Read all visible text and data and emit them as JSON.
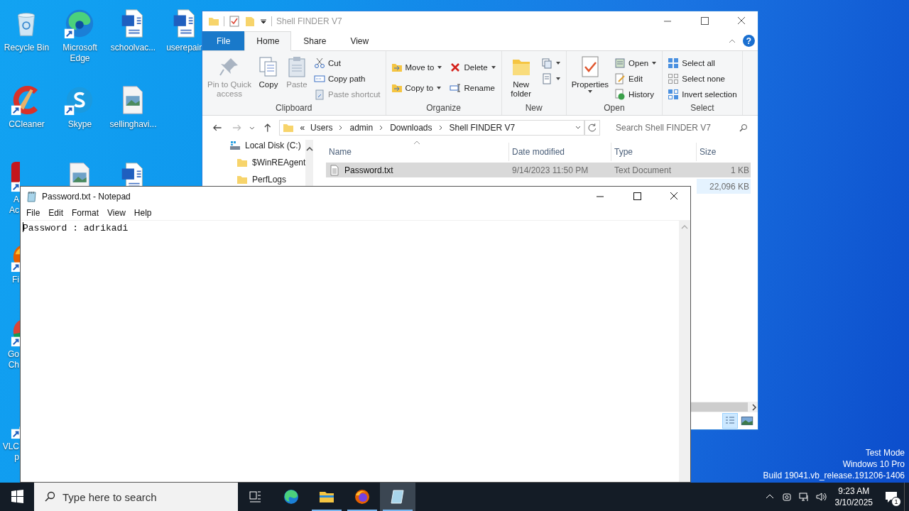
{
  "desktop_icons": [
    {
      "kind": "recycle",
      "label": "Recycle Bin"
    },
    {
      "kind": "edge",
      "label": "Microsoft Edge",
      "shortcut": true
    },
    {
      "kind": "word",
      "label": "schoolvac..."
    },
    {
      "kind": "word",
      "label": "userepair."
    },
    {
      "kind": "ccleaner",
      "label": "CCleaner",
      "shortcut": true
    },
    {
      "kind": "skype",
      "label": "Skype",
      "shortcut": true
    },
    {
      "kind": "image",
      "label": "sellinghavi..."
    },
    {
      "kind": "acrobat",
      "label": "A Ac",
      "shortcut": true
    },
    {
      "kind": "image"
    },
    {
      "kind": "word"
    },
    {
      "kind": "firefox",
      "label": "Fi",
      "shortcut": true
    },
    {
      "kind": "chrome",
      "label": "Go Ch",
      "shortcut": true
    },
    {
      "kind": "vlc",
      "label": "VLC p",
      "shortcut": true
    }
  ],
  "explorer": {
    "title": "Shell FINDER V7",
    "help": "?",
    "tabs": [
      {
        "label": "File",
        "kind": "file",
        "selected": false
      },
      {
        "label": "Home",
        "kind": "tab",
        "selected": true
      },
      {
        "label": "Share",
        "kind": "tab",
        "selected": false
      },
      {
        "label": "View",
        "kind": "tab",
        "selected": false
      }
    ],
    "ribbon": [
      {
        "label": "Clipboard",
        "items": [
          {
            "kind": "large",
            "label": "Pin to Quick access",
            "disabled": true
          },
          {
            "kind": "large",
            "label": "Copy",
            "disabled": false
          },
          {
            "kind": "large",
            "label": "Paste",
            "disabled": true
          },
          {
            "kind": "small",
            "label": "Cut",
            "disabled": false
          },
          {
            "kind": "small",
            "label": "Copy path",
            "disabled": false
          },
          {
            "kind": "small",
            "label": "Paste shortcut",
            "disabled": true
          }
        ]
      },
      {
        "label": "Organize",
        "items": [
          {
            "kind": "small",
            "label": "Move to",
            "dropdown": true
          },
          {
            "kind": "small",
            "label": "Copy to",
            "dropdown": true
          },
          {
            "kind": "small",
            "label": "Delete",
            "dropdown": true
          },
          {
            "kind": "small",
            "label": "Rename",
            "dropdown": false
          }
        ]
      },
      {
        "label": "New",
        "items": [
          {
            "kind": "large",
            "label": "New folder"
          },
          {
            "kind": "icon",
            "dropdown": true
          },
          {
            "kind": "icon",
            "dropdown": true
          }
        ]
      },
      {
        "label": "Open",
        "items": [
          {
            "kind": "large",
            "label": "Properties",
            "dropdown": true
          },
          {
            "kind": "small",
            "label": "Open",
            "dropdown": true
          },
          {
            "kind": "small",
            "label": "Edit"
          },
          {
            "kind": "small",
            "label": "History"
          }
        ]
      },
      {
        "label": "Select",
        "items": [
          {
            "kind": "small",
            "label": "Select all"
          },
          {
            "kind": "small",
            "label": "Select none"
          },
          {
            "kind": "small",
            "label": "Invert selection"
          }
        ]
      }
    ],
    "address": {
      "overflow": "«",
      "path": [
        "Users",
        "admin",
        "Downloads",
        "Shell FINDER V7"
      ]
    },
    "search": {
      "placeholder": "Search Shell FINDER V7"
    },
    "nav": [
      {
        "kind": "drive",
        "label": "Local Disk (C:)"
      },
      {
        "kind": "folder",
        "label": "$WinREAgent"
      },
      {
        "kind": "folder",
        "label": "PerfLogs"
      }
    ],
    "columns": [
      "Name",
      "Date modified",
      "Type",
      "Size"
    ],
    "rows": [
      {
        "kind": "text",
        "name": "Password.txt",
        "date": "9/14/2023 11:50 PM",
        "type": "Text Document",
        "size": "1 KB",
        "selected": true,
        "hover": false
      },
      {
        "size": "22,096 KB",
        "selected": false,
        "hover": true
      }
    ]
  },
  "notepad": {
    "title": "Password.txt - Notepad",
    "menu": [
      "File",
      "Edit",
      "Format",
      "View",
      "Help"
    ],
    "text": "Password : adrikadi"
  },
  "taskbar": {
    "search": {
      "placeholder": "Type here to search"
    },
    "apps": [
      {
        "kind": "taskview",
        "running": false,
        "selected": false
      },
      {
        "kind": "edge",
        "running": false,
        "selected": false
      },
      {
        "kind": "explorer",
        "running": true,
        "selected": false
      },
      {
        "kind": "firefox",
        "running": true,
        "selected": false
      },
      {
        "kind": "notepad",
        "running": true,
        "selected": true
      }
    ],
    "time": "9:23 AM",
    "date": "3/10/2025",
    "notifications": "1"
  },
  "watermark": [
    "Test Mode",
    "Windows 10 Pro",
    "Build 19041.vb_release.191206-1406"
  ]
}
